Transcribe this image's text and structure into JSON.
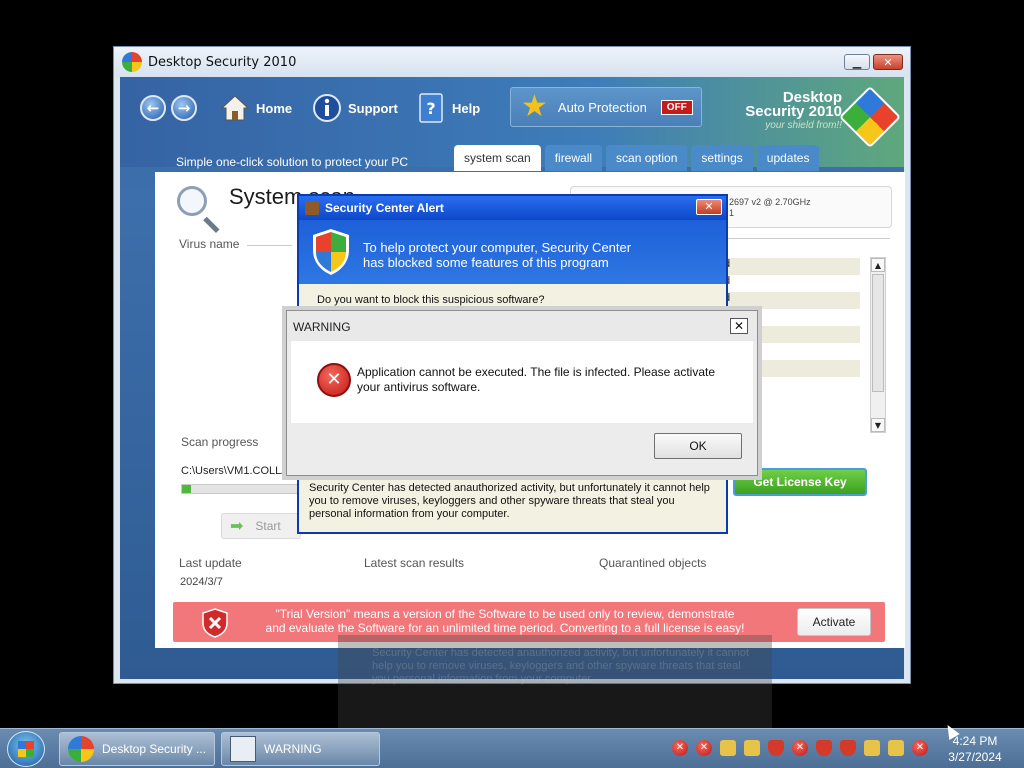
{
  "app": {
    "title": "Desktop Security 2010",
    "nav": {
      "home": "Home",
      "support": "Support",
      "help": "Help",
      "auto_protection_label": "Auto Protection",
      "auto_protection_state": "OFF"
    },
    "brand": {
      "line1": "Desktop",
      "line2": "Security 2010",
      "tagline_small": "your shield from!!"
    },
    "tagline": "Simple one-click solution to protect your PC",
    "tabs": [
      "system scan",
      "firewall",
      "scan option",
      "settings",
      "updates"
    ],
    "scan": {
      "title": "System scan",
      "cpu_text_line1": "2697 v2 @ 2.70GHz",
      "cpu_text_line2": "1",
      "virus_name_label": "Virus name",
      "result_rows": [
        "d",
        "d",
        "d",
        "",
        "",
        "",
        "",
        ""
      ],
      "scan_progress_label": "Scan progress",
      "current_path": "C:\\Users\\VM1.COLLAB",
      "progress_fraction": 0.08,
      "start_label": "Start",
      "get_license_label": "Get License Key",
      "last_update_label": "Last update",
      "last_update_date": "2024/3/7",
      "latest_results_label": "Latest scan results",
      "quarantined_label": "Quarantined objects"
    },
    "trial": {
      "line1": "\"Trial Version\" means a version of the Software to be used only to review, demonstrate",
      "line2": "and evaluate the Software for an unlimited time period. Converting to a full license is easy!",
      "activate_label": "Activate"
    }
  },
  "security_alert": {
    "title": "Security Center Alert",
    "header_line1": "To help protect your computer, Security Center",
    "header_line2": "has blocked some features of this program",
    "question": "Do you want to block this suspicious software?",
    "body": "Security Center has detected anauthorized activity, but unfortunately it cannot help you to remove viruses, keyloggers and other spyware threats that steal you personal information from your computer."
  },
  "warning": {
    "title": "WARNING",
    "message": "Application cannot be executed. The file is infected. Please activate your antivirus software.",
    "ok_label": "OK"
  },
  "taskbar": {
    "items": [
      {
        "label": "Desktop Security ..."
      },
      {
        "label": "WARNING"
      }
    ],
    "clock_time": "4:24 PM",
    "clock_date": "3/27/2024"
  },
  "colors": {
    "alert_blue": "#1d5fd8",
    "trial_red": "#f1777a",
    "license_green": "#3da01f",
    "off_badge": "#c51b1b"
  }
}
